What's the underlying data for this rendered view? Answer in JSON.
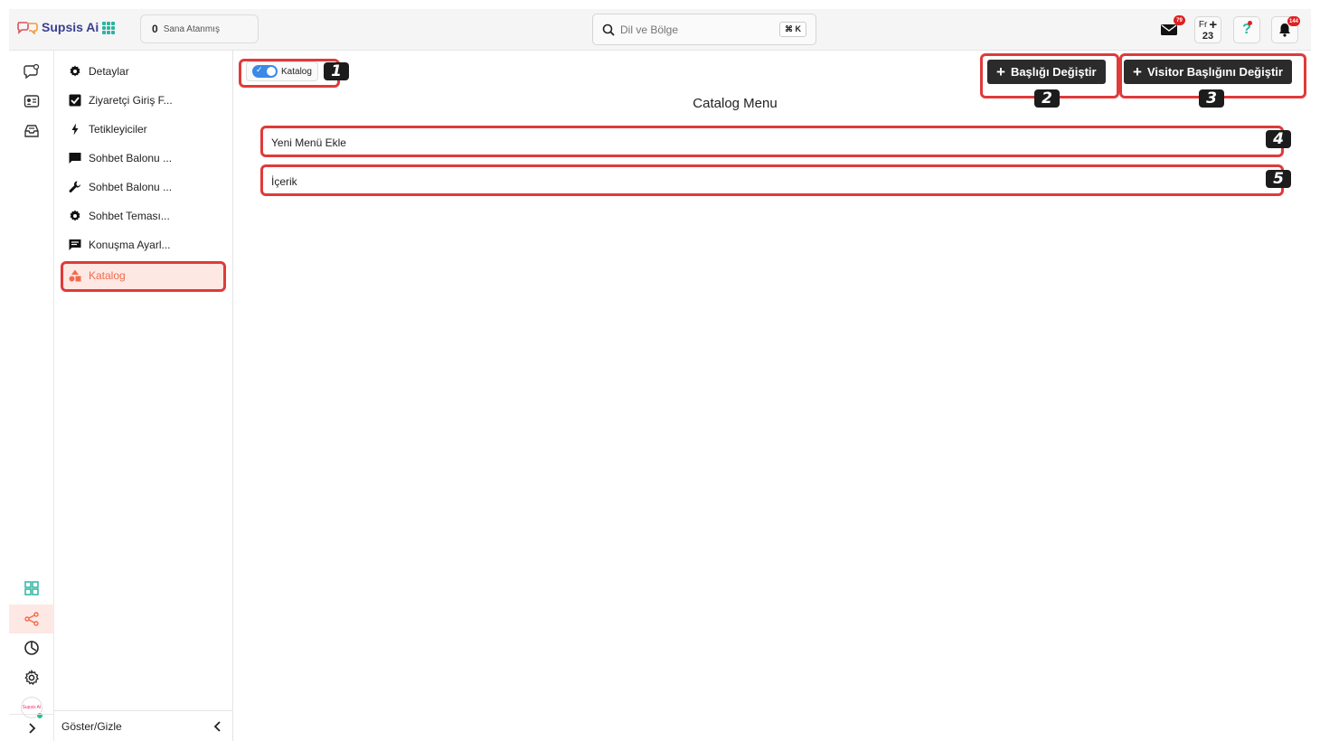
{
  "app": {
    "brand": "Supsis Ai",
    "assigned": {
      "count": "0",
      "label": "Sana Atanmış"
    },
    "search": {
      "placeholder": "Dil ve Bölge",
      "shortcut": "⌘ K"
    },
    "mail_badge": "79",
    "calendar": {
      "day_abbr": "Fr",
      "date": "23"
    },
    "help_glyph": "?",
    "notif_badge": "144"
  },
  "rail": {
    "icons": [
      "chat-bubble-icon",
      "contact-card-icon",
      "inbox-icon",
      "dashboard-grid-icon",
      "share-nodes-icon",
      "clock-chart-icon",
      "settings-gear-icon"
    ],
    "avatar_text": "Supsis AI"
  },
  "sidemenu": {
    "items": [
      {
        "label": "Detaylar",
        "icon": "gear-icon"
      },
      {
        "label": "Ziyaretçi Giriş F...",
        "icon": "checkbox-icon"
      },
      {
        "label": "Tetikleyiciler",
        "icon": "bolt-icon"
      },
      {
        "label": "Sohbet Balonu ...",
        "icon": "chat-icon"
      },
      {
        "label": "Sohbet Balonu ...",
        "icon": "wrench-icon"
      },
      {
        "label": "Sohbet Teması...",
        "icon": "gear-icon"
      },
      {
        "label": "Konuşma Ayarl...",
        "icon": "message-icon"
      },
      {
        "label": "Katalog",
        "icon": "shapes-icon"
      }
    ],
    "footer_label": "Göster/Gizle"
  },
  "main": {
    "toggle_label": "Katalog",
    "toggle_on": true,
    "btn_change_title": "Başlığı Değiştir",
    "btn_change_visitor_title": "Visitor Başlığını Değiştir",
    "title": "Catalog Menu",
    "rows": [
      "Yeni Menü Ekle",
      "İçerik"
    ]
  },
  "annotations": [
    "1",
    "2",
    "3",
    "4",
    "5"
  ],
  "colors": {
    "accent": "#f26a4b",
    "annotation": "#e03a3a",
    "dark_button": "#2b2b2b",
    "toggle": "#3a8ae6"
  }
}
